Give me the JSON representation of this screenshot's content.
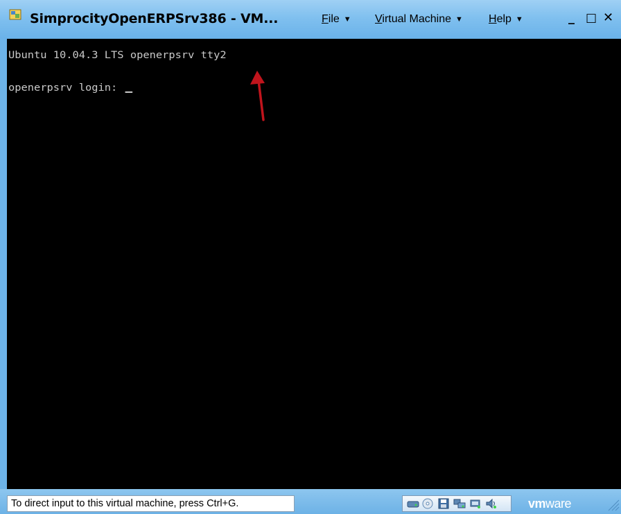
{
  "window": {
    "title": "SimprocityOpenERPSrv386 - VM...",
    "app_icon": "vmware-app-icon"
  },
  "menubar": {
    "items": [
      {
        "label": "File",
        "accel": "F",
        "rest": "ile"
      },
      {
        "label": "Virtual Machine",
        "accel": "V",
        "rest": "irtual Machine"
      },
      {
        "label": "Help",
        "accel": "H",
        "rest": "elp"
      }
    ],
    "dropdown_icon": "triangle-down-icon"
  },
  "controls": {
    "minimize": "_",
    "restore": "□",
    "close": "✕"
  },
  "console": {
    "banner": "Ubuntu 10.04.3 LTS openerpsrv tty2",
    "prompt": "openerpsrv login: ",
    "annotation": "red-arrow-pointing-up"
  },
  "statusbar": {
    "message": "To direct input to this virtual machine, press Ctrl+G.",
    "devices": [
      "hard-disk-icon",
      "cd-rom-icon",
      "floppy-icon",
      "network-adapter-icon",
      "usb-icon",
      "sound-icon"
    ],
    "brand_bold": "vm",
    "brand_light": "ware"
  },
  "colors": {
    "chrome": "#6db3e8",
    "console_bg": "#000000",
    "console_text": "#c9c9c9",
    "arrow": "#c0141c"
  }
}
